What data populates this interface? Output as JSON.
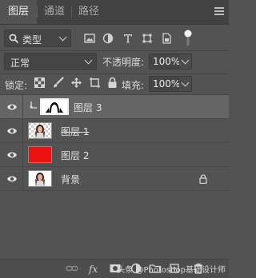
{
  "tabs": [
    {
      "label": "图层",
      "active": true
    },
    {
      "label": "通道",
      "active": false
    },
    {
      "label": "路径",
      "active": false
    }
  ],
  "filter": {
    "type_label": "类型"
  },
  "blend": {
    "mode": "正常",
    "opacity_label": "不透明度:",
    "opacity_value": "100%"
  },
  "lock": {
    "label": "锁定:",
    "fill_label": "填充:",
    "fill_value": "100%"
  },
  "layers": [
    {
      "name": "图层 3",
      "selected": true,
      "clipped": true,
      "strikethrough": false
    },
    {
      "name": "图层 1",
      "selected": false,
      "clipped": false,
      "strikethrough": true
    },
    {
      "name": "图层 2",
      "selected": false,
      "clipped": false,
      "strikethrough": false
    },
    {
      "name": "背景",
      "selected": false,
      "clipped": false,
      "strikethrough": false,
      "locked": true
    }
  ],
  "watermark": "头条 @Photoshop基础设计师",
  "colors": {
    "panel": "#535353",
    "selected_row": "#656565",
    "red_fill": "#ee1111"
  }
}
